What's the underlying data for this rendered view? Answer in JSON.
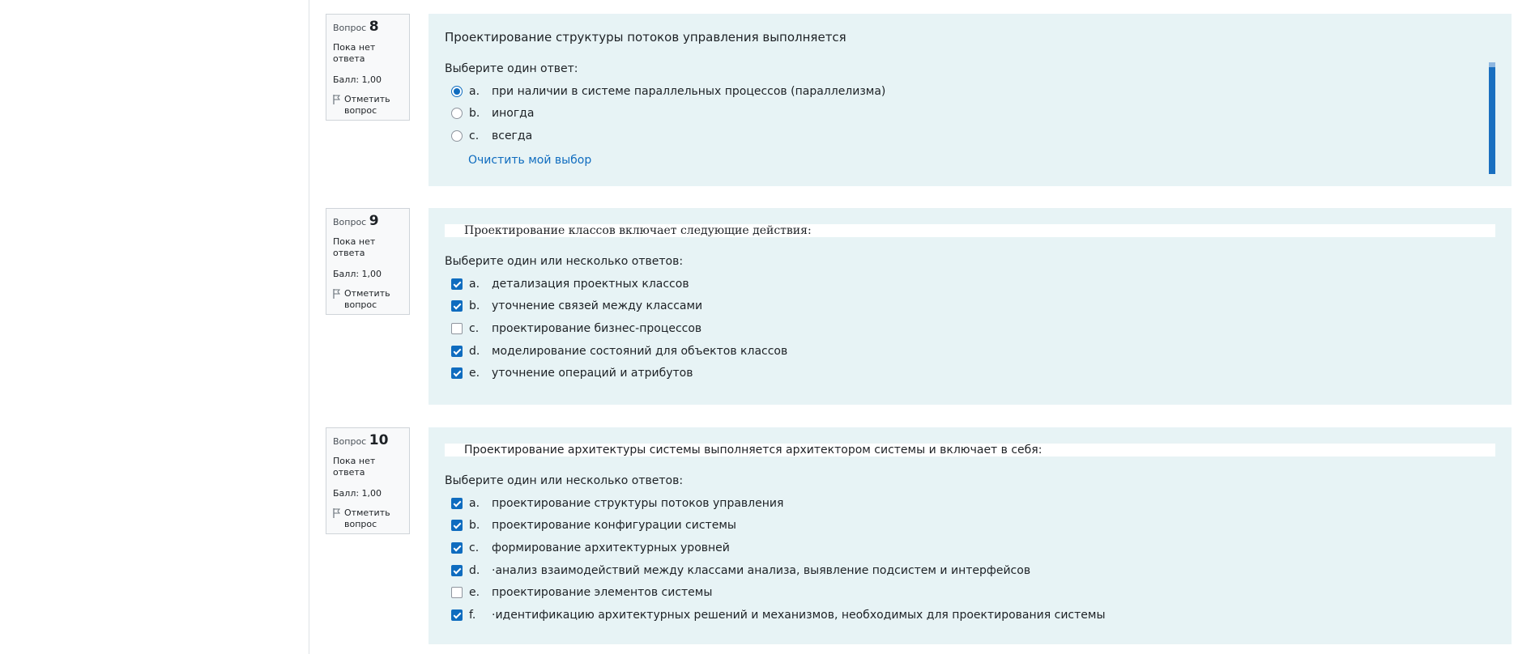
{
  "questions": [
    {
      "label": "Вопрос",
      "number": "8",
      "state": "Пока нет ответа",
      "grade": "Балл: 1,00",
      "flag_line1": "Отметить",
      "flag_line2": "вопрос",
      "text": "Проектирование структуры потоков управления выполняется",
      "prompt": "Выберите один ответ:",
      "type": "radio",
      "answers": [
        {
          "letter": "a.",
          "text": "при наличии в системе параллельных процессов (параллелизма)",
          "checked": true
        },
        {
          "letter": "b.",
          "text": "иногда",
          "checked": false
        },
        {
          "letter": "c.",
          "text": "всегда",
          "checked": false
        }
      ],
      "clear_label": "Очистить мой выбор"
    },
    {
      "label": "Вопрос",
      "number": "9",
      "state": "Пока нет ответа",
      "grade": "Балл: 1,00",
      "flag_line1": "Отметить",
      "flag_line2": "вопрос",
      "text": "Проектирование классов включает следующие действия:",
      "prompt": "Выберите один или несколько ответов:",
      "type": "checkbox",
      "answers": [
        {
          "letter": "a.",
          "text": "детализация проектных классов",
          "checked": true
        },
        {
          "letter": "b.",
          "text": "уточнение связей между классами",
          "checked": true
        },
        {
          "letter": "c.",
          "text": "проектирование бизнес-процессов",
          "checked": false
        },
        {
          "letter": "d.",
          "text": "моделирование состояний для объектов классов",
          "checked": true
        },
        {
          "letter": "e.",
          "text": "уточнение операций и атрибутов",
          "checked": true
        }
      ]
    },
    {
      "label": "Вопрос",
      "number": "10",
      "state": "Пока нет ответа",
      "grade": "Балл: 1,00",
      "flag_line1": "Отметить",
      "flag_line2": "вопрос",
      "text": "Проектирование архитектуры системы выполняется архитектором системы и включает в себя:",
      "prompt": "Выберите один или несколько ответов:",
      "type": "checkbox",
      "answers": [
        {
          "letter": "a.",
          "text": "проектирование структуры потоков управления",
          "checked": true
        },
        {
          "letter": "b.",
          "text": "проектирование конфигурации системы",
          "checked": true
        },
        {
          "letter": "c.",
          "text": "формирование архитектурных уровней",
          "checked": true
        },
        {
          "letter": "d.",
          "text": "·анализ взаимодействий между классами анализа, выявление подсистем и интерфейсов",
          "checked": true
        },
        {
          "letter": "e.",
          "text": "проектирование элементов системы",
          "checked": false
        },
        {
          "letter": "f.",
          "text": "·идентификацию архитектурных решений и механизмов, необходимых для проектирования системы",
          "checked": true
        }
      ]
    }
  ],
  "colors": {
    "accent": "#0f6cbf",
    "content_bg": "#e7f3f5",
    "info_bg": "#f8f9fa"
  }
}
